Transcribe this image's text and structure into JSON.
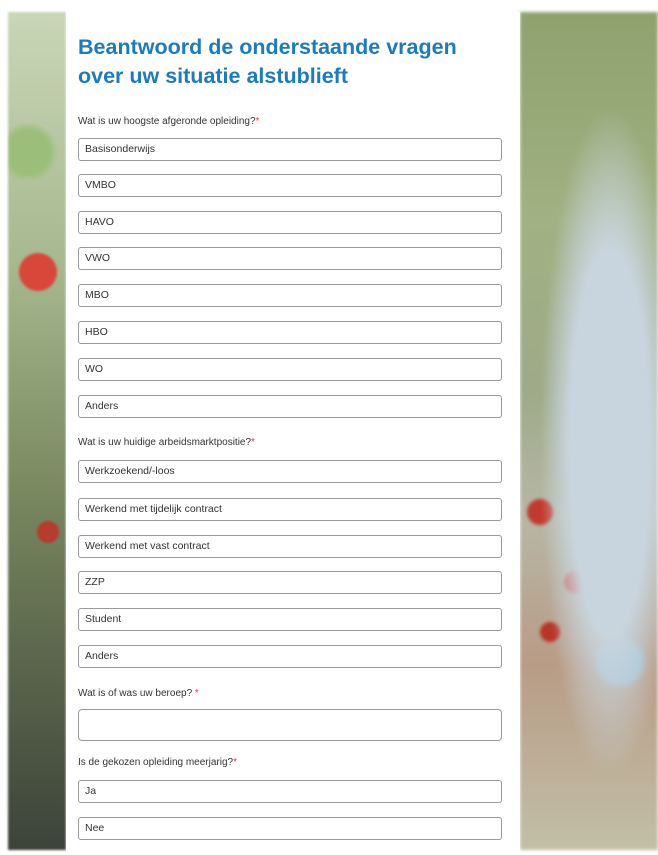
{
  "title": "Beantwoord de onderstaande vragen over uw situatie alstublieft",
  "required_marker": "*",
  "q1": {
    "label": "Wat is uw hoogste afgeronde opleiding?",
    "options": [
      "Basisonderwijs",
      "VMBO",
      "HAVO",
      "VWO",
      "MBO",
      "HBO",
      "WO",
      "Anders"
    ]
  },
  "q2": {
    "label": "Wat is uw huidige arbeidsmarktpositie?",
    "options": [
      "Werkzoekend/-loos",
      "Werkend met tijdelijk contract",
      "Werkend met vast contract",
      "ZZP",
      "Student",
      "Anders"
    ]
  },
  "q3": {
    "label": "Wat is of was uw beroep? ",
    "value": ""
  },
  "q4": {
    "label": "Is de gekozen opleiding meerjarig?",
    "options": [
      "Ja",
      "Nee"
    ]
  },
  "colors": {
    "title": "#1b7bc1",
    "required": "#e2384a",
    "border": "#9a9a9a"
  }
}
